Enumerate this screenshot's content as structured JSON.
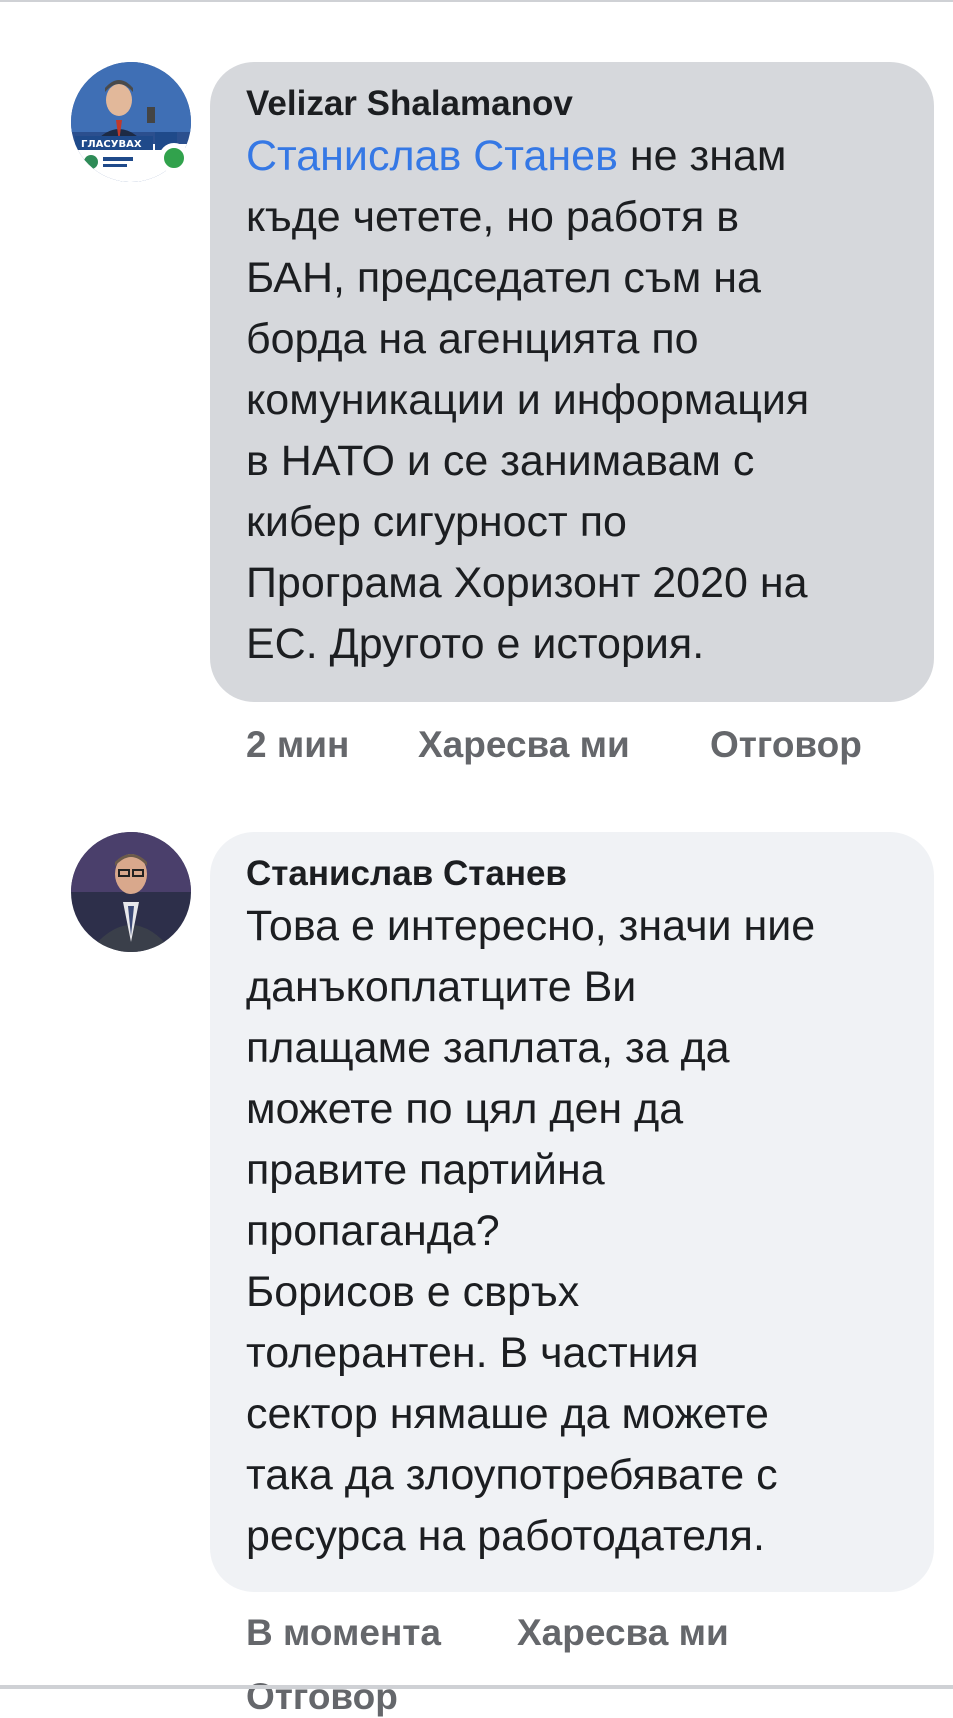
{
  "comments": [
    {
      "author": "Velizar Shalamanov",
      "mention": "Станислав Станев",
      "text_after_mention": " не знам\nкъде четете, но работя в\nБАН, председател съм на\nборда на агенцията по\nкомуникации и информация\nв НАТО и се занимавам с\nкибер сигурност по\nПрограма Хоризонт 2020 на\nЕС. Другото е история.",
      "time": "2 мин",
      "like_label": "Харесва ми",
      "reply_label": "Отговор",
      "avatar_badge_text": "ГЛАСУВАХ",
      "online": true
    },
    {
      "author": "Станислав Станев",
      "text": "Това е интересно, значи ние\nданъкоплатците Ви\nплащаме заплата, за да\nможете по цял ден да\nправите партийна\nпропаганда?\nБорисов е свръх\nтолерантен. В частния\nсектор нямаше да можете\nтака да злоупотребявате с\nресурса на работодателя.",
      "time": "В момента",
      "like_label": "Харесва ми",
      "reply_label": "Отговор"
    }
  ],
  "colors": {
    "mention": "#3578e5",
    "bubble_dark": "#d6d8dc",
    "bubble_light": "#f0f2f5",
    "meta": "#65676b",
    "online": "#31a24c"
  }
}
